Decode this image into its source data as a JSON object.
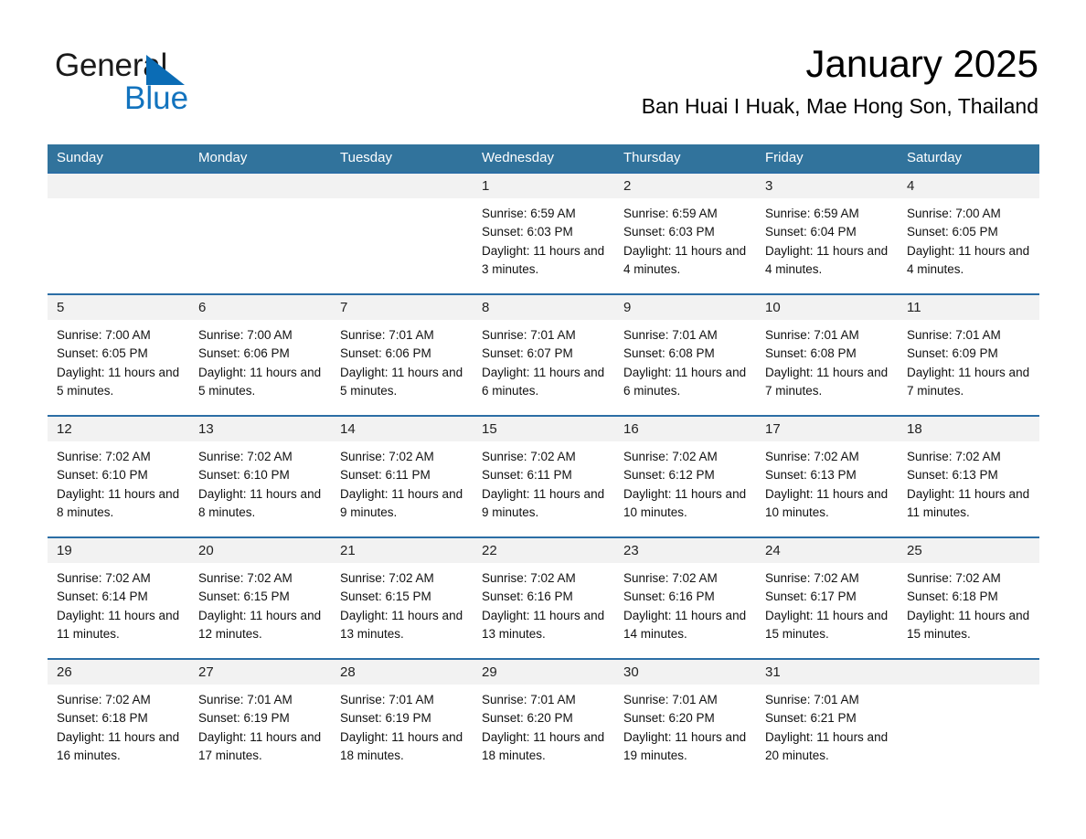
{
  "brand": {
    "name_part1": "General",
    "name_part2": "Blue",
    "accent_color": "#1273be",
    "triangle_color": "#0b6cb5"
  },
  "header": {
    "month_title": "January 2025",
    "location": "Ban Huai I Huak, Mae Hong Son, Thailand"
  },
  "calendar": {
    "header_color": "#31739c",
    "row_divider_color": "#2c6ea5",
    "daynum_band_color": "#f2f2f2",
    "weekdays": [
      "Sunday",
      "Monday",
      "Tuesday",
      "Wednesday",
      "Thursday",
      "Friday",
      "Saturday"
    ],
    "weeks": [
      [
        {
          "day": "",
          "sunrise": "",
          "sunset": "",
          "daylight": ""
        },
        {
          "day": "",
          "sunrise": "",
          "sunset": "",
          "daylight": ""
        },
        {
          "day": "",
          "sunrise": "",
          "sunset": "",
          "daylight": ""
        },
        {
          "day": "1",
          "sunrise": "Sunrise: 6:59 AM",
          "sunset": "Sunset: 6:03 PM",
          "daylight": "Daylight: 11 hours and 3 minutes."
        },
        {
          "day": "2",
          "sunrise": "Sunrise: 6:59 AM",
          "sunset": "Sunset: 6:03 PM",
          "daylight": "Daylight: 11 hours and 4 minutes."
        },
        {
          "day": "3",
          "sunrise": "Sunrise: 6:59 AM",
          "sunset": "Sunset: 6:04 PM",
          "daylight": "Daylight: 11 hours and 4 minutes."
        },
        {
          "day": "4",
          "sunrise": "Sunrise: 7:00 AM",
          "sunset": "Sunset: 6:05 PM",
          "daylight": "Daylight: 11 hours and 4 minutes."
        }
      ],
      [
        {
          "day": "5",
          "sunrise": "Sunrise: 7:00 AM",
          "sunset": "Sunset: 6:05 PM",
          "daylight": "Daylight: 11 hours and 5 minutes."
        },
        {
          "day": "6",
          "sunrise": "Sunrise: 7:00 AM",
          "sunset": "Sunset: 6:06 PM",
          "daylight": "Daylight: 11 hours and 5 minutes."
        },
        {
          "day": "7",
          "sunrise": "Sunrise: 7:01 AM",
          "sunset": "Sunset: 6:06 PM",
          "daylight": "Daylight: 11 hours and 5 minutes."
        },
        {
          "day": "8",
          "sunrise": "Sunrise: 7:01 AM",
          "sunset": "Sunset: 6:07 PM",
          "daylight": "Daylight: 11 hours and 6 minutes."
        },
        {
          "day": "9",
          "sunrise": "Sunrise: 7:01 AM",
          "sunset": "Sunset: 6:08 PM",
          "daylight": "Daylight: 11 hours and 6 minutes."
        },
        {
          "day": "10",
          "sunrise": "Sunrise: 7:01 AM",
          "sunset": "Sunset: 6:08 PM",
          "daylight": "Daylight: 11 hours and 7 minutes."
        },
        {
          "day": "11",
          "sunrise": "Sunrise: 7:01 AM",
          "sunset": "Sunset: 6:09 PM",
          "daylight": "Daylight: 11 hours and 7 minutes."
        }
      ],
      [
        {
          "day": "12",
          "sunrise": "Sunrise: 7:02 AM",
          "sunset": "Sunset: 6:10 PM",
          "daylight": "Daylight: 11 hours and 8 minutes."
        },
        {
          "day": "13",
          "sunrise": "Sunrise: 7:02 AM",
          "sunset": "Sunset: 6:10 PM",
          "daylight": "Daylight: 11 hours and 8 minutes."
        },
        {
          "day": "14",
          "sunrise": "Sunrise: 7:02 AM",
          "sunset": "Sunset: 6:11 PM",
          "daylight": "Daylight: 11 hours and 9 minutes."
        },
        {
          "day": "15",
          "sunrise": "Sunrise: 7:02 AM",
          "sunset": "Sunset: 6:11 PM",
          "daylight": "Daylight: 11 hours and 9 minutes."
        },
        {
          "day": "16",
          "sunrise": "Sunrise: 7:02 AM",
          "sunset": "Sunset: 6:12 PM",
          "daylight": "Daylight: 11 hours and 10 minutes."
        },
        {
          "day": "17",
          "sunrise": "Sunrise: 7:02 AM",
          "sunset": "Sunset: 6:13 PM",
          "daylight": "Daylight: 11 hours and 10 minutes."
        },
        {
          "day": "18",
          "sunrise": "Sunrise: 7:02 AM",
          "sunset": "Sunset: 6:13 PM",
          "daylight": "Daylight: 11 hours and 11 minutes."
        }
      ],
      [
        {
          "day": "19",
          "sunrise": "Sunrise: 7:02 AM",
          "sunset": "Sunset: 6:14 PM",
          "daylight": "Daylight: 11 hours and 11 minutes."
        },
        {
          "day": "20",
          "sunrise": "Sunrise: 7:02 AM",
          "sunset": "Sunset: 6:15 PM",
          "daylight": "Daylight: 11 hours and 12 minutes."
        },
        {
          "day": "21",
          "sunrise": "Sunrise: 7:02 AM",
          "sunset": "Sunset: 6:15 PM",
          "daylight": "Daylight: 11 hours and 13 minutes."
        },
        {
          "day": "22",
          "sunrise": "Sunrise: 7:02 AM",
          "sunset": "Sunset: 6:16 PM",
          "daylight": "Daylight: 11 hours and 13 minutes."
        },
        {
          "day": "23",
          "sunrise": "Sunrise: 7:02 AM",
          "sunset": "Sunset: 6:16 PM",
          "daylight": "Daylight: 11 hours and 14 minutes."
        },
        {
          "day": "24",
          "sunrise": "Sunrise: 7:02 AM",
          "sunset": "Sunset: 6:17 PM",
          "daylight": "Daylight: 11 hours and 15 minutes."
        },
        {
          "day": "25",
          "sunrise": "Sunrise: 7:02 AM",
          "sunset": "Sunset: 6:18 PM",
          "daylight": "Daylight: 11 hours and 15 minutes."
        }
      ],
      [
        {
          "day": "26",
          "sunrise": "Sunrise: 7:02 AM",
          "sunset": "Sunset: 6:18 PM",
          "daylight": "Daylight: 11 hours and 16 minutes."
        },
        {
          "day": "27",
          "sunrise": "Sunrise: 7:01 AM",
          "sunset": "Sunset: 6:19 PM",
          "daylight": "Daylight: 11 hours and 17 minutes."
        },
        {
          "day": "28",
          "sunrise": "Sunrise: 7:01 AM",
          "sunset": "Sunset: 6:19 PM",
          "daylight": "Daylight: 11 hours and 18 minutes."
        },
        {
          "day": "29",
          "sunrise": "Sunrise: 7:01 AM",
          "sunset": "Sunset: 6:20 PM",
          "daylight": "Daylight: 11 hours and 18 minutes."
        },
        {
          "day": "30",
          "sunrise": "Sunrise: 7:01 AM",
          "sunset": "Sunset: 6:20 PM",
          "daylight": "Daylight: 11 hours and 19 minutes."
        },
        {
          "day": "31",
          "sunrise": "Sunrise: 7:01 AM",
          "sunset": "Sunset: 6:21 PM",
          "daylight": "Daylight: 11 hours and 20 minutes."
        },
        {
          "day": "",
          "sunrise": "",
          "sunset": "",
          "daylight": ""
        }
      ]
    ]
  }
}
